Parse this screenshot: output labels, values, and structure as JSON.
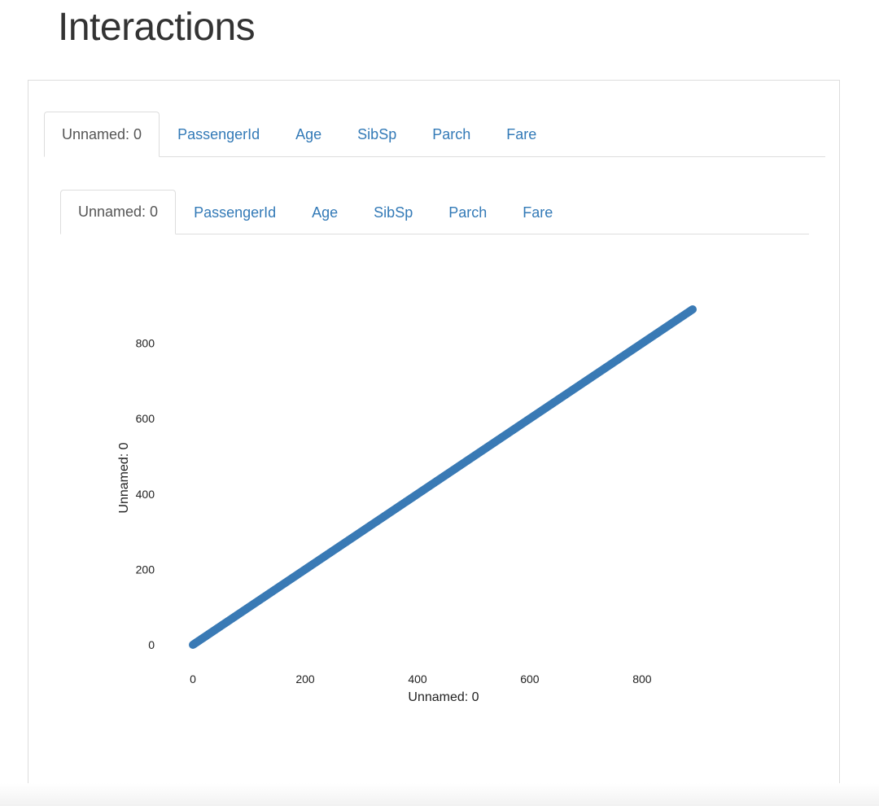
{
  "page": {
    "title": "Interactions"
  },
  "outer_tabs": [
    {
      "label": "Unnamed: 0",
      "active": true
    },
    {
      "label": "PassengerId",
      "active": false
    },
    {
      "label": "Age",
      "active": false
    },
    {
      "label": "SibSp",
      "active": false
    },
    {
      "label": "Parch",
      "active": false
    },
    {
      "label": "Fare",
      "active": false
    }
  ],
  "inner_tabs": [
    {
      "label": "Unnamed: 0",
      "active": true
    },
    {
      "label": "PassengerId",
      "active": false
    },
    {
      "label": "Age",
      "active": false
    },
    {
      "label": "SibSp",
      "active": false
    },
    {
      "label": "Parch",
      "active": false
    },
    {
      "label": "Fare",
      "active": false
    }
  ],
  "chart_data": {
    "type": "scatter",
    "xlabel": "Unnamed: 0",
    "ylabel": "Unnamed: 0",
    "x_ticks": [
      0,
      200,
      400,
      600,
      800
    ],
    "y_ticks": [
      0,
      200,
      400,
      800,
      600
    ],
    "x_tick_labels": [
      "0",
      "200",
      "400",
      "600",
      "800"
    ],
    "y_tick_labels": [
      "0",
      "200",
      "400",
      "600",
      "800"
    ],
    "xlim": [
      0,
      890
    ],
    "ylim": [
      0,
      890
    ],
    "series": [
      {
        "x_start": 0,
        "x_end": 890,
        "step": 1,
        "y_equals_x": true
      }
    ],
    "color": "#3a7ab5",
    "grid": false
  }
}
